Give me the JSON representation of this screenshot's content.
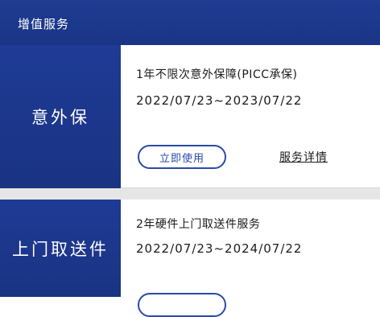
{
  "header": {
    "title": "增值服务"
  },
  "services": [
    {
      "name": "意外保",
      "description": "1年不限次意外保障(PICC承保)",
      "validity": "2022/07/23~2023/07/22",
      "action_label": "立即使用",
      "detail_label": "服务详情"
    },
    {
      "name": "上门取送件",
      "description": "2年硬件上门取送件服务",
      "validity": "2022/07/23~2024/07/22",
      "action_label": "",
      "detail_label": ""
    }
  ],
  "colors": {
    "brand": "#1e3b95",
    "button_border": "#2a4aa6",
    "divider": "#e6e6e6"
  }
}
